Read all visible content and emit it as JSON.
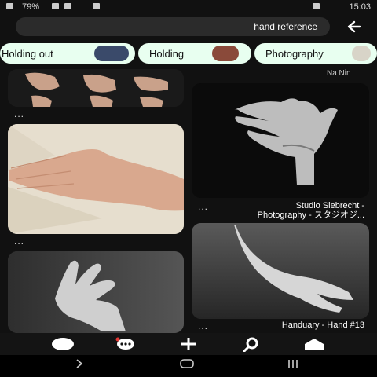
{
  "status_bar": {
    "time": "15:03",
    "battery": "79%"
  },
  "search": {
    "query": "hand reference"
  },
  "chips": [
    {
      "label": "Photography",
      "thumb_color": "#d8d4c8"
    },
    {
      "label": "Holding",
      "thumb_color": "#8a4a3a"
    },
    {
      "label": "Holding out",
      "thumb_color": "#3a4a6a"
    }
  ],
  "pins": {
    "right_top": {
      "author": "Na Nin",
      "caption_line1": "Studio Siebrecht -",
      "caption_line2": "Photography - スタジオジ..."
    },
    "right_bottom": {
      "caption": "Handuary - Hand #13"
    },
    "more_label": "..."
  },
  "tabs": [
    "home",
    "search",
    "create",
    "messages",
    "profile"
  ],
  "system_nav": [
    "back",
    "home",
    "recents"
  ]
}
